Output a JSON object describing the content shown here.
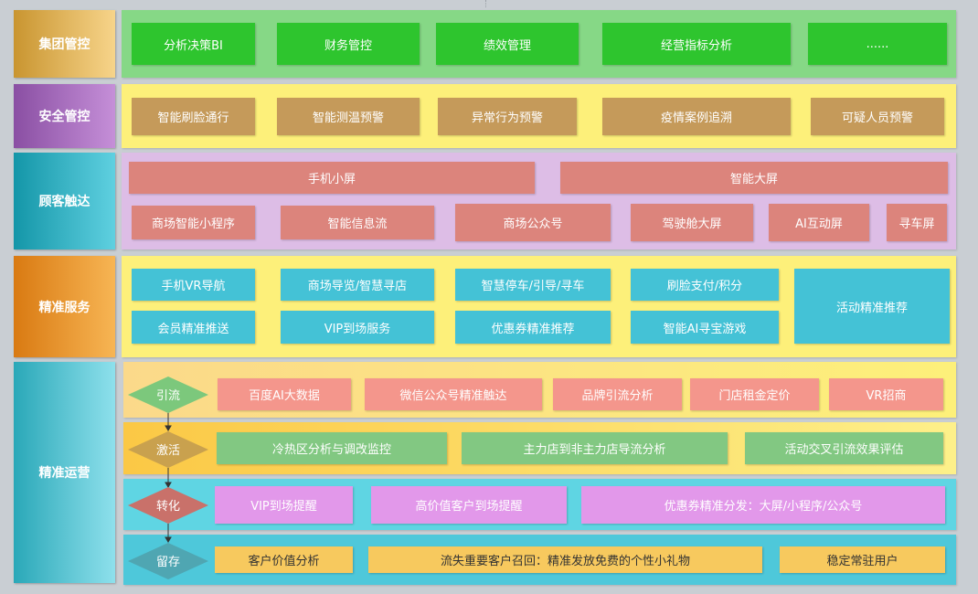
{
  "categories": [
    {
      "key": "group",
      "label": "集团管控",
      "color_from": "#c99530",
      "color_to": "#f7d48a"
    },
    {
      "key": "security",
      "label": "安全管控",
      "color_from": "#8a4fa3",
      "color_to": "#c58fd8"
    },
    {
      "key": "customer",
      "label": "顾客触达",
      "color_from": "#1496a8",
      "color_to": "#5fd0e0"
    },
    {
      "key": "service",
      "label": "精准服务",
      "color_from": "#d97a12",
      "color_to": "#f7b554"
    },
    {
      "key": "operation",
      "label": "精准运营",
      "color_from": "#2aa8b8",
      "color_to": "#8ee0ec"
    }
  ],
  "group": {
    "items": [
      "分析决策BI",
      "财务管控",
      "绩效管理",
      "经营指标分析",
      "......"
    ]
  },
  "security": {
    "items": [
      "智能刷脸通行",
      "智能测温预警",
      "异常行为预警",
      "疫情案例追溯",
      "可疑人员预警"
    ]
  },
  "customer": {
    "row1": [
      "手机小屏",
      "智能大屏"
    ],
    "row2": [
      "商场智能小程序",
      "智能信息流",
      "商场公众号",
      "驾驶舱大屏",
      "AI互动屏",
      "寻车屏"
    ]
  },
  "service": {
    "row1": [
      "手机VR导航",
      "商场导览/智慧寻店",
      "智慧停车/引导/寻车",
      "刷脸支付/积分"
    ],
    "row2": [
      "会员精准推送",
      "VIP到场服务",
      "优惠券精准推荐",
      "智能AI寻宝游戏"
    ],
    "tall": "活动精准推荐"
  },
  "operation": {
    "stages": [
      {
        "key": "attract",
        "label": "引流",
        "diamond_color": "#7cc87c",
        "items": [
          "百度AI大数据",
          "微信公众号精准触达",
          "品牌引流分析",
          "门店租金定价",
          "VR招商"
        ]
      },
      {
        "key": "activate",
        "label": "激活",
        "diamond_color": "#c9a14e",
        "items": [
          "冷热区分析与调改监控",
          "主力店到非主力店导流分析",
          "活动交叉引流效果评估"
        ]
      },
      {
        "key": "convert",
        "label": "转化",
        "diamond_color": "#c9716a",
        "items": [
          "VIP到场提醒",
          "高价值客户到场提醒",
          "优惠券精准分发：大屏/小程序/公众号"
        ]
      },
      {
        "key": "retain",
        "label": "留存",
        "diamond_color": "#4fa6b2",
        "items": [
          "客户价值分析",
          "流失重要客户召回：精准发放免费的个性小礼物",
          "稳定常驻用户"
        ]
      }
    ]
  }
}
